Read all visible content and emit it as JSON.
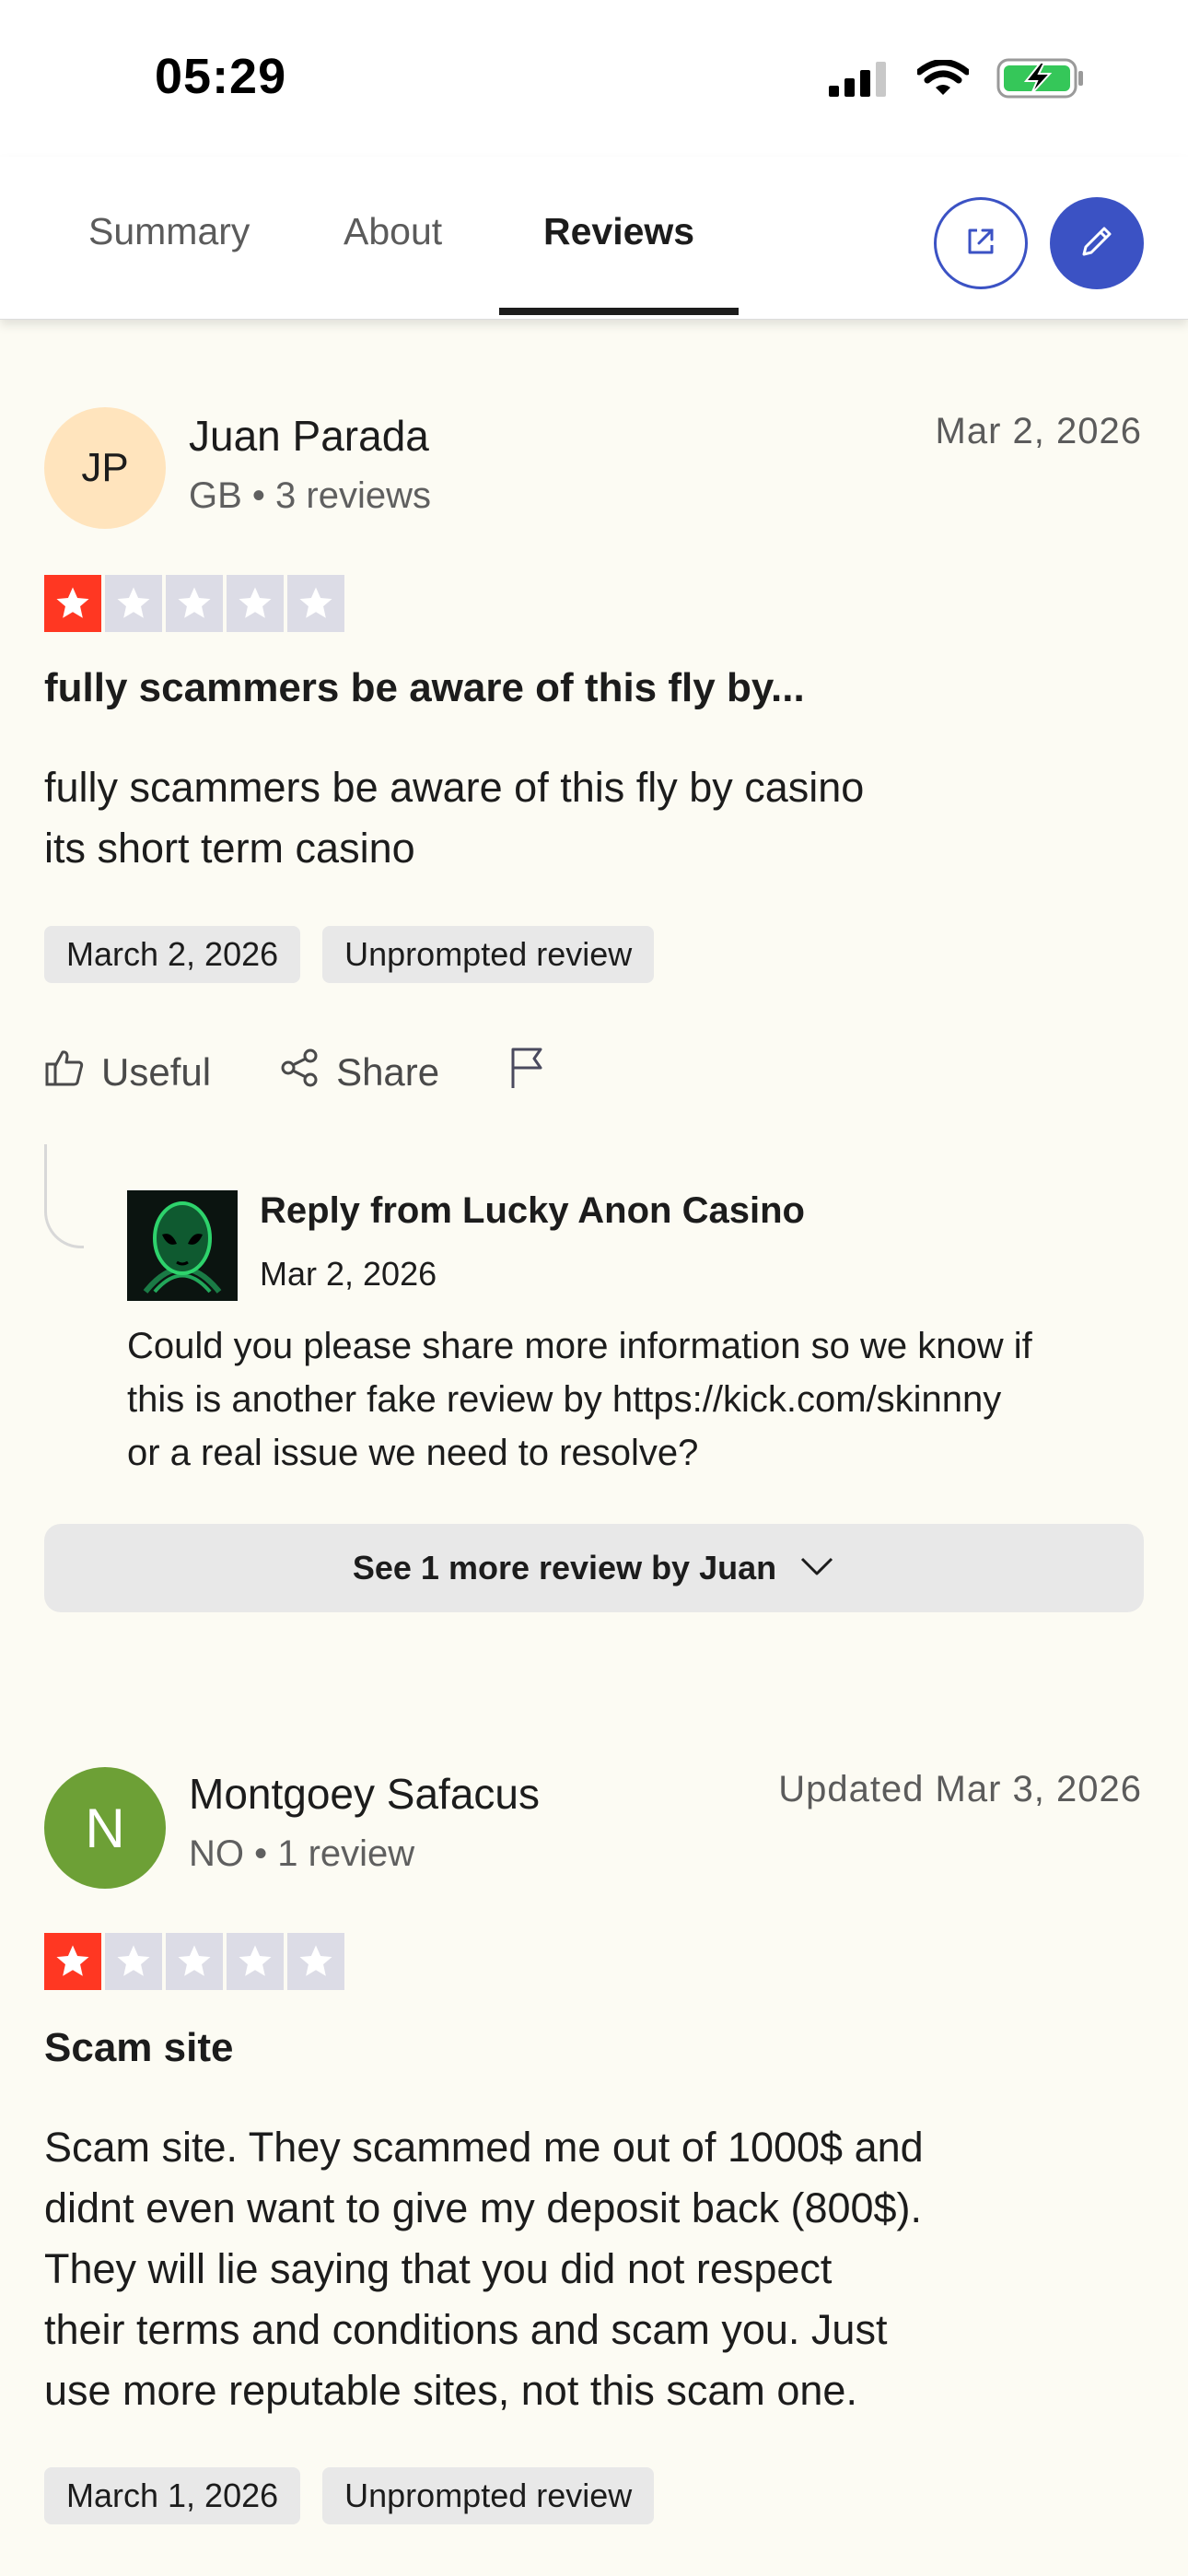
{
  "status_bar": {
    "time": "05:29",
    "icons": [
      "cellular-signal-icon",
      "wifi-icon",
      "battery-charging-icon"
    ]
  },
  "nav": {
    "tabs": [
      {
        "label": "Summary",
        "active": false
      },
      {
        "label": "About",
        "active": false
      },
      {
        "label": "Reviews",
        "active": true
      }
    ],
    "buttons": [
      "external-link-icon",
      "pencil-icon"
    ]
  },
  "colors": {
    "accent": "#3b52c4",
    "star_red": "#ff3722",
    "star_empty": "#dcdce6",
    "avatar_jp": "#ffe4bd",
    "avatar_n": "#6da036"
  },
  "reviews": [
    {
      "initials": "JP",
      "name": "Juan Parada",
      "meta": "GB • 3 reviews",
      "date": "Mar 2, 2026",
      "rating": 1,
      "title": "fully scammers be aware of this fly by...",
      "body_lines": [
        "fully scammers be aware of this fly by casino",
        "its short term casino"
      ],
      "tags": [
        "March 2, 2026",
        "Unprompted review"
      ],
      "actions": {
        "useful": "Useful",
        "share": "Share"
      },
      "reply": {
        "from": "Reply from Lucky Anon Casino",
        "date": "Mar 2, 2026",
        "text_lines": [
          "Could you please share more information so we know if",
          "this is another fake review by https://kick.com/skinnny",
          "or a real issue we need to resolve?"
        ]
      },
      "see_more": "See 1 more review by Juan"
    },
    {
      "initials": "N",
      "name": "Montgoey Safacus",
      "meta": "NO • 1 review",
      "date": "Updated Mar 3, 2026",
      "rating": 1,
      "title": "Scam site",
      "body_lines": [
        "Scam site. They scammed me out of 1000$ and",
        "didnt even want to give my deposit back (800$).",
        "They will lie saying that you did not respect",
        "their terms and conditions and scam you. Just",
        "use more reputable sites, not this scam one."
      ],
      "tags": [
        "March 1, 2026",
        "Unprompted review"
      ]
    }
  ]
}
